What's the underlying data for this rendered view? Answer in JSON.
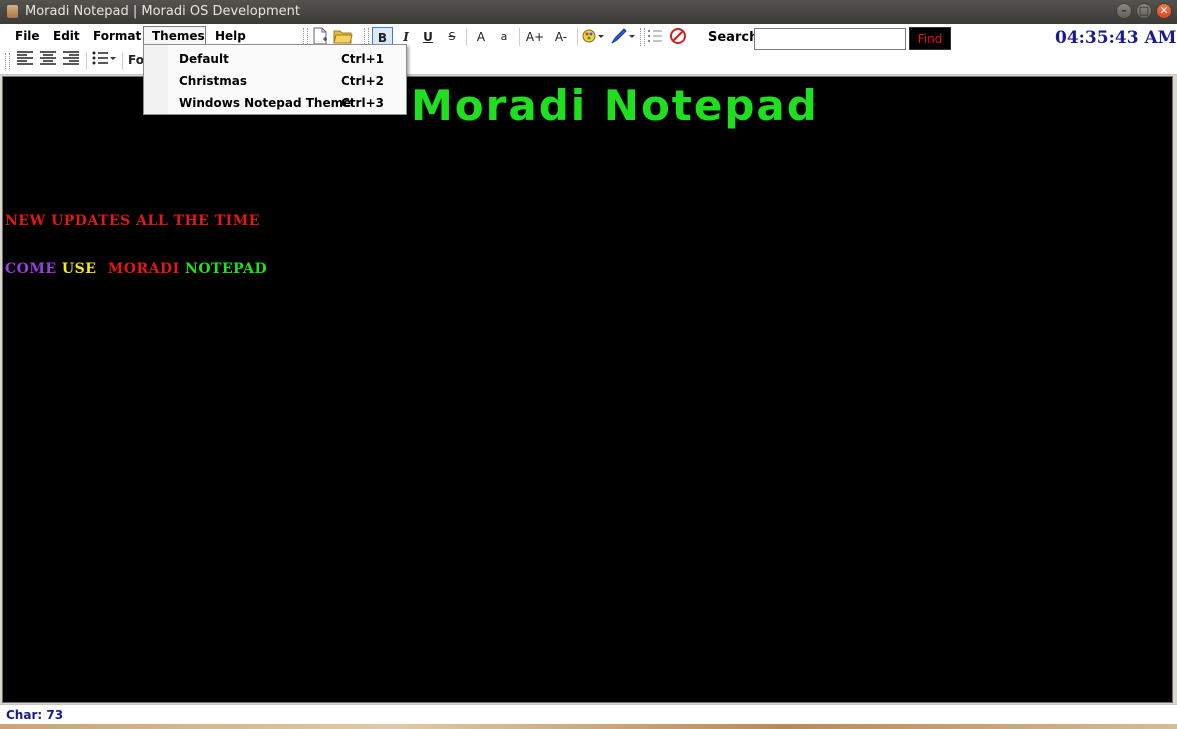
{
  "window": {
    "title": "Moradi Notepad | Moradi OS Development",
    "minimize_glyph": "–",
    "maximize_glyph": "□",
    "close_glyph": "✕"
  },
  "menubar": {
    "items": [
      {
        "label": "File"
      },
      {
        "label": "Edit"
      },
      {
        "label": "Format"
      },
      {
        "label": "Themes",
        "active": true
      },
      {
        "label": "Help"
      }
    ]
  },
  "toolbar": {
    "bold": "B",
    "italic": "I",
    "underline": "U",
    "strike": "S",
    "font_a_large": "A",
    "font_a_small": "a",
    "grow_font": "A+",
    "shrink_font": "A-",
    "font_label_partial": "Fo"
  },
  "search": {
    "label": "Search",
    "value": "",
    "find_label": "Find"
  },
  "clock": "04:35:43 AM",
  "themes_menu": {
    "items": [
      {
        "label": "Default",
        "shortcut": "Ctrl+1"
      },
      {
        "label": "Christmas",
        "shortcut": "Ctrl+2"
      },
      {
        "label": "Windows Notepad Theme",
        "shortcut": "Ctrl+3"
      }
    ]
  },
  "document": {
    "title": "Moradi Notepad",
    "line1": "New updates all the time",
    "line2": {
      "word1": "Come",
      "word2": "use",
      "word3": "Moradi",
      "word4": "Notepad"
    }
  },
  "colors": {
    "title_green": "#1fe01f",
    "red": "#e01818",
    "purple": "#9b3be0",
    "yellow": "#f2ea1b",
    "green": "#1fe01f",
    "clock_blue": "#1a1a8c"
  },
  "status": {
    "char_count": "Char: 73"
  }
}
